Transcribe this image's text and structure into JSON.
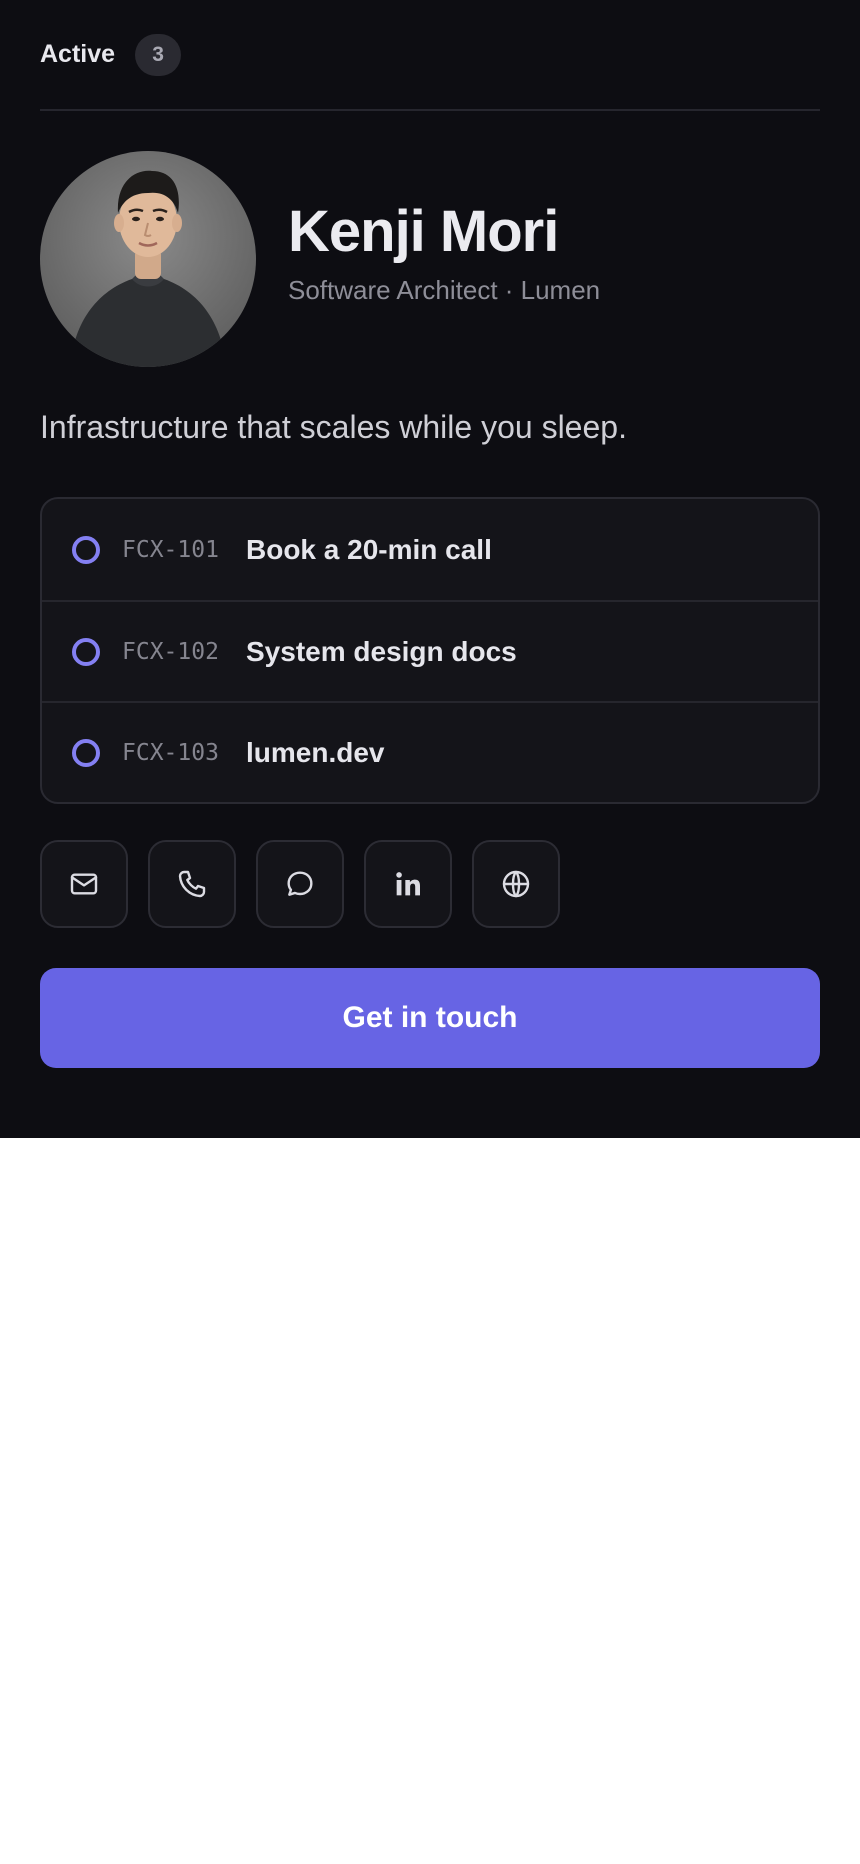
{
  "status": {
    "label": "Active",
    "count": "3"
  },
  "profile": {
    "name": "Kenji Mori",
    "role_line": "Software Architect · Lumen",
    "tagline": "Infrastructure that scales while you sleep."
  },
  "links": [
    {
      "code": "FCX-101",
      "title": "Book a 20-min call"
    },
    {
      "code": "FCX-102",
      "title": "System design docs"
    },
    {
      "code": "FCX-103",
      "title": "lumen.dev"
    }
  ],
  "socials": [
    "mail-icon",
    "phone-icon",
    "chat-icon",
    "linkedin-icon",
    "globe-icon"
  ],
  "cta": {
    "label": "Get in touch"
  },
  "colors": {
    "accent": "#6764e4",
    "ring": "#8480f2",
    "background": "#0d0d12"
  }
}
